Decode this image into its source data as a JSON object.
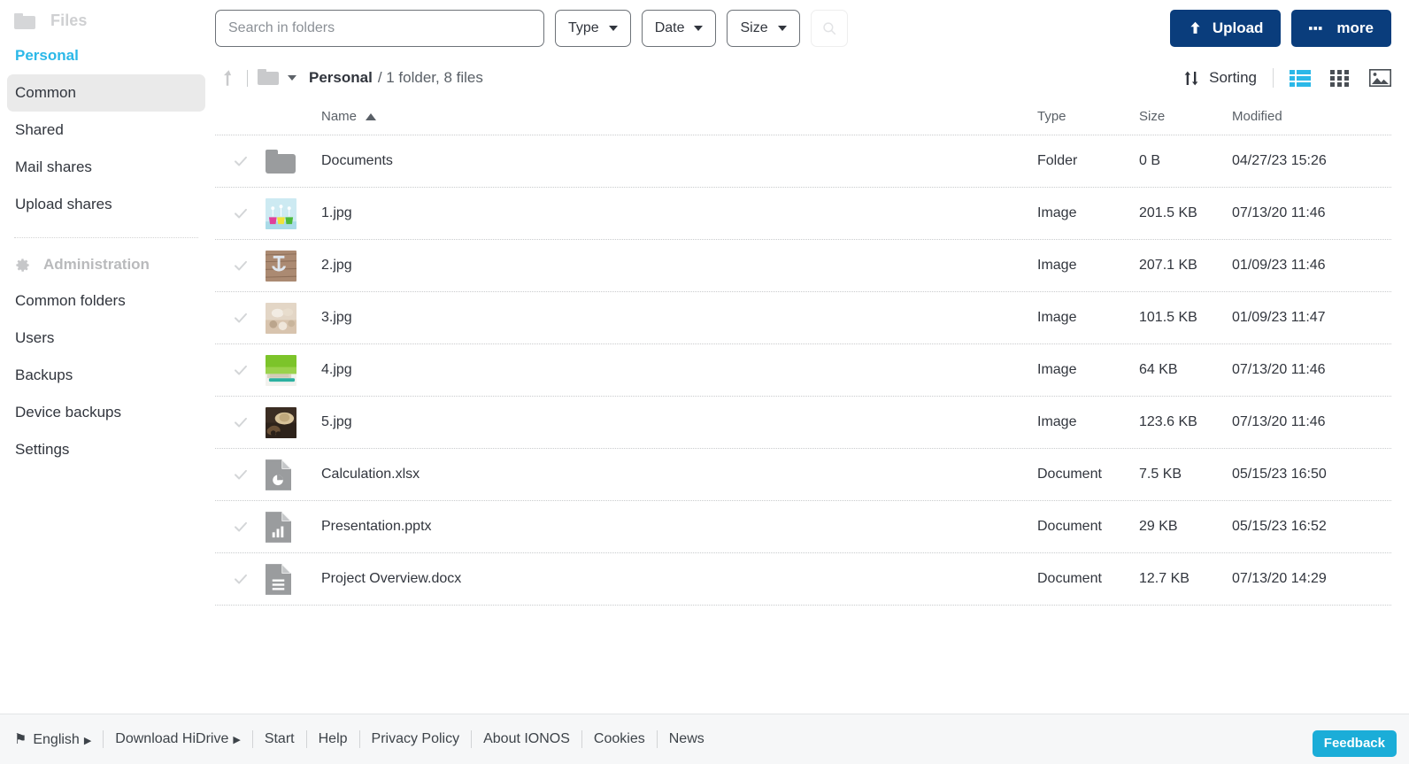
{
  "sidebar": {
    "files_section": {
      "label": "Files",
      "icon": "folder-icon"
    },
    "items": [
      {
        "label": "Personal",
        "state": "active"
      },
      {
        "label": "Common",
        "state": "hover"
      },
      {
        "label": "Shared",
        "state": "normal"
      },
      {
        "label": "Mail shares",
        "state": "normal"
      },
      {
        "label": "Upload shares",
        "state": "normal"
      }
    ],
    "admin_section": {
      "label": "Administration",
      "icon": "gear-icon"
    },
    "admin_items": [
      {
        "label": "Common folders"
      },
      {
        "label": "Users"
      },
      {
        "label": "Backups"
      },
      {
        "label": "Device backups"
      },
      {
        "label": "Settings"
      }
    ]
  },
  "toolbar": {
    "search_placeholder": "Search in folders",
    "search_value": "",
    "filters": [
      {
        "label": "Type"
      },
      {
        "label": "Date"
      },
      {
        "label": "Size"
      }
    ],
    "search_button_icon": "search-icon",
    "upload_label": "Upload",
    "upload_icon": "upload-arrow-icon",
    "more_label": "more",
    "more_icon": "ellipsis-icon"
  },
  "breadcrumb": {
    "up_icon": "up-arrow-icon",
    "folder_icon": "folder-icon",
    "dropdown_icon": "chevron-down-icon",
    "current": "Personal",
    "meta": "/ 1 folder, 8 files"
  },
  "view_controls": {
    "sorting_label": "Sorting",
    "sorting_icon": "sort-updown-icon",
    "views": [
      {
        "name": "list-view-icon",
        "active": true
      },
      {
        "name": "grid-view-icon",
        "active": false
      },
      {
        "name": "gallery-view-icon",
        "active": false
      }
    ]
  },
  "table": {
    "columns": [
      "Name",
      "Type",
      "Size",
      "Modified"
    ],
    "sort_column": "Name",
    "sort_direction": "asc",
    "rows": [
      {
        "name": "Documents",
        "type": "Folder",
        "size": "0 B",
        "modified": "04/27/23 15:26",
        "icon": "folder-icon"
      },
      {
        "name": "1.jpg",
        "type": "Image",
        "size": "201.5 KB",
        "modified": "07/13/20 11:46",
        "icon": "image-thumbnail"
      },
      {
        "name": "2.jpg",
        "type": "Image",
        "size": "207.1 KB",
        "modified": "01/09/23 11:46",
        "icon": "image-thumbnail"
      },
      {
        "name": "3.jpg",
        "type": "Image",
        "size": "101.5 KB",
        "modified": "01/09/23 11:47",
        "icon": "image-thumbnail"
      },
      {
        "name": "4.jpg",
        "type": "Image",
        "size": "64 KB",
        "modified": "07/13/20 11:46",
        "icon": "image-thumbnail"
      },
      {
        "name": "5.jpg",
        "type": "Image",
        "size": "123.6 KB",
        "modified": "07/13/20 11:46",
        "icon": "image-thumbnail"
      },
      {
        "name": "Calculation.xlsx",
        "type": "Document",
        "size": "7.5 KB",
        "modified": "05/15/23 16:50",
        "icon": "spreadsheet-file-icon"
      },
      {
        "name": "Presentation.pptx",
        "type": "Document",
        "size": "29 KB",
        "modified": "05/15/23 16:52",
        "icon": "presentation-file-icon"
      },
      {
        "name": "Project Overview.docx",
        "type": "Document",
        "size": "12.7 KB",
        "modified": "07/13/20 14:29",
        "icon": "text-file-icon"
      }
    ]
  },
  "footer": {
    "language": "English",
    "links": [
      "Download HiDrive",
      "Start",
      "Help",
      "Privacy Policy",
      "About IONOS",
      "Cookies",
      "News"
    ],
    "feedback_label": "Feedback"
  },
  "colors": {
    "accent_cyan": "#2bb8e8",
    "primary_blue": "#0a3d7c",
    "feedback_blue": "#1badd8",
    "text": "#31353d"
  }
}
